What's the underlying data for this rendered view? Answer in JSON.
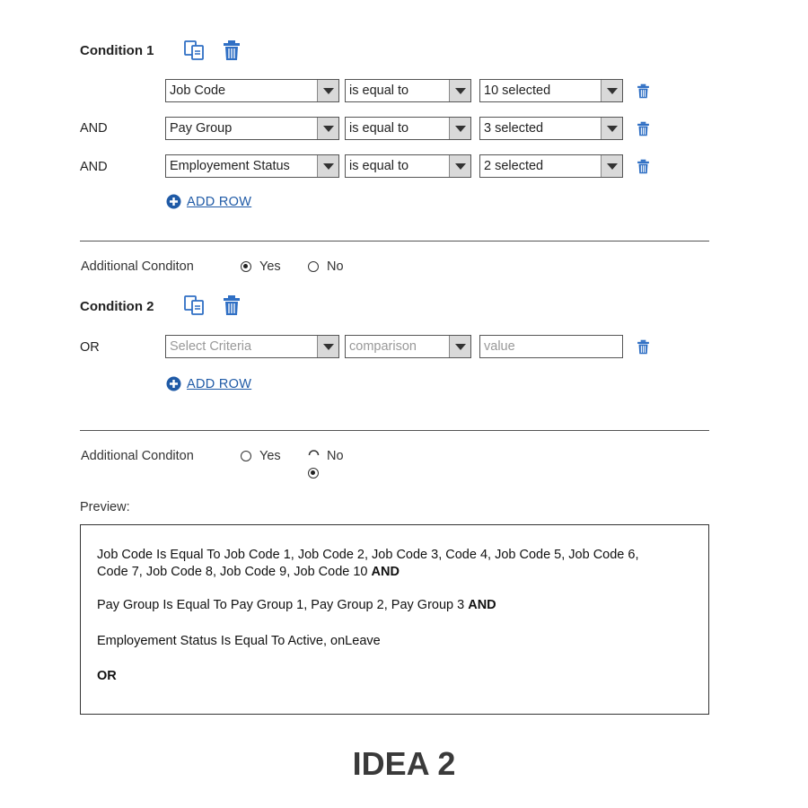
{
  "condition1": {
    "title": "Condition 1",
    "rows": [
      {
        "conjunction": "",
        "criteria": "Job Code",
        "comparison": "is equal to",
        "value": "10 selected"
      },
      {
        "conjunction": "AND",
        "criteria": "Pay Group",
        "comparison": "is equal to",
        "value": "3 selected"
      },
      {
        "conjunction": "AND",
        "criteria": "Employement Status",
        "comparison": "is equal to",
        "value": "2 selected"
      }
    ],
    "add_row_label": "ADD ROW"
  },
  "additional1": {
    "label": "Additional Conditon",
    "yes": "Yes",
    "no": "No",
    "selected": "Yes"
  },
  "condition2": {
    "title": "Condition 2",
    "rows": [
      {
        "conjunction": "OR",
        "criteria_placeholder": "Select Criteria",
        "comparison_placeholder": "comparison",
        "value_placeholder": "value"
      }
    ],
    "add_row_label": "ADD ROW"
  },
  "additional2": {
    "label": "Additional Conditon",
    "yes": "Yes",
    "no": "No",
    "selected": "No"
  },
  "preview": {
    "label": "Preview:",
    "line1a": "Job Code Is Equal To Job Code 1, Job Code 2, Job Code 3, Code 4, Job Code 5, Job Code 6,",
    "line1b": "Code 7, Job Code 8, Job Code 9, Job Code 10 ",
    "line1b_conj": "AND",
    "line2": "Pay Group Is Equal To Pay Group 1, Pay Group 2, Pay Group 3 ",
    "line2_conj": "AND",
    "line3": "Employement Status Is Equal To Active, onLeave",
    "line4": "OR"
  },
  "footer": {
    "title": "IDEA 2"
  },
  "colors": {
    "accent": "#2f6fc4",
    "link": "#1f5aa6"
  }
}
